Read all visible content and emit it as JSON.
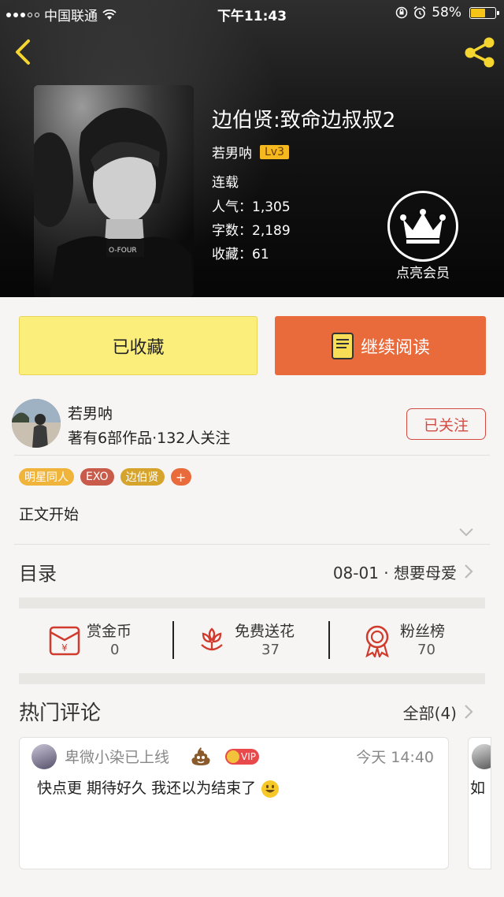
{
  "status_bar": {
    "carrier": "中国联通",
    "time": "下午11:43",
    "battery": "58%"
  },
  "book": {
    "title": "边伯贤:致命边叔叔2",
    "author": "若男呐",
    "level": "Lv3",
    "status": "连载",
    "popularity": "人气：1,305",
    "word_count": "字数：2,189",
    "favorites": "收藏：61"
  },
  "vip": {
    "label": "点亮会员"
  },
  "actions": {
    "favorite_label": "已收藏",
    "read_label": "继续阅读"
  },
  "author_card": {
    "name": "若男呐",
    "stats": "著有6部作品·132人关注",
    "follow_label": "已关注"
  },
  "tags": [
    "明星同人",
    "EXO",
    "边伯贤",
    "+"
  ],
  "intro": "正文开始",
  "toc": {
    "label": "目录",
    "latest": "08-01 · 想要母爱"
  },
  "stats": [
    {
      "label": "赏金币",
      "value": "0",
      "icon": "red-envelope-icon"
    },
    {
      "label": "免费送花",
      "value": "37",
      "icon": "flower-icon"
    },
    {
      "label": "粉丝榜",
      "value": "70",
      "icon": "medal-icon"
    }
  ],
  "comments_section": {
    "title": "热门评论",
    "all_label": "全部(4)"
  },
  "comments": [
    {
      "user": "卑微小染已上线",
      "vip_label": "VIP",
      "time": "今天 14:40",
      "text": "快点更 期待好久 我还以为结束了"
    },
    {
      "text": "如"
    }
  ],
  "colors": {
    "accent_orange": "#e96a3b",
    "favorite_yellow": "#fbee7a",
    "follow_red": "#d44b41",
    "level_badge": "#f5b81e"
  }
}
